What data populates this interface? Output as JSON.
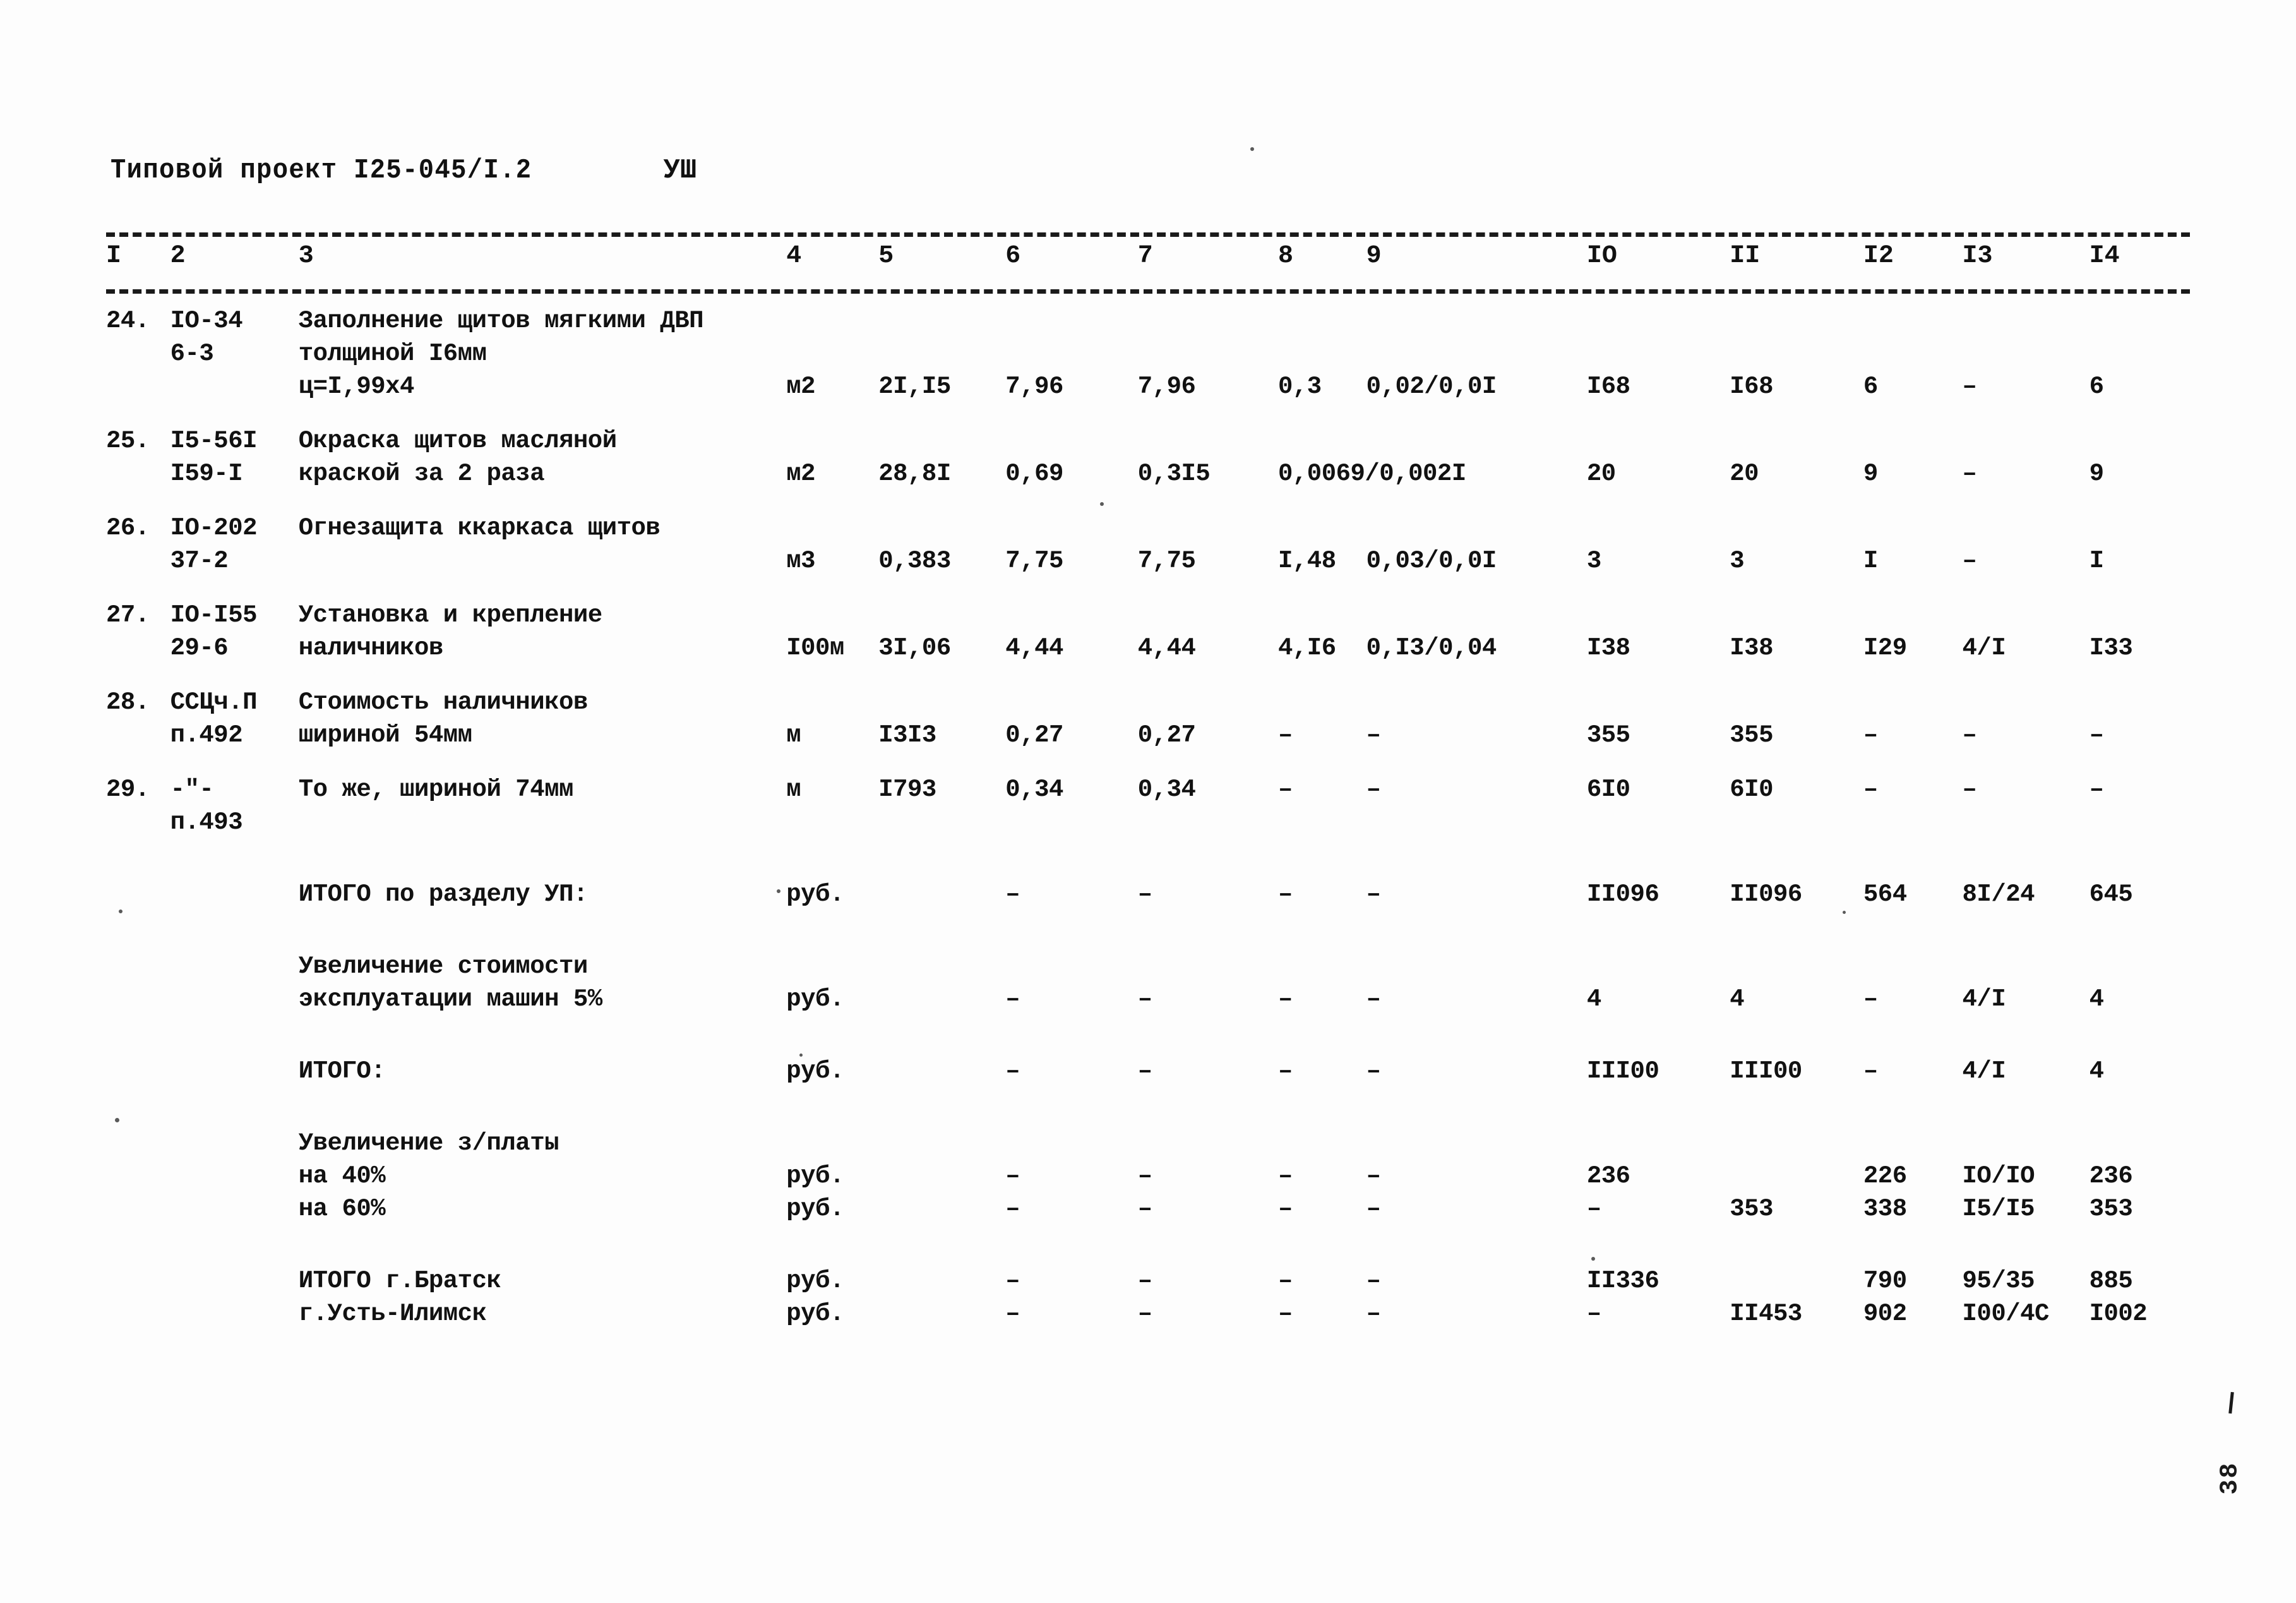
{
  "document": {
    "title": "Типовой проект I25-045/I.2",
    "section": "УШ",
    "page_number": "38"
  },
  "table": {
    "column_headers": [
      "I",
      "2",
      "3",
      "4",
      "5",
      "6",
      "7",
      "8",
      "9",
      "IO",
      "II",
      "I2",
      "I3",
      "I4"
    ],
    "rows": [
      {
        "num": "24.",
        "code_lines": [
          "IO-34",
          "6-3"
        ],
        "desc_lines": [
          "Заполнение щитов мягкими ДВП",
          "толщиной I6мм",
          "ц=I,99х4"
        ],
        "unit": "м2",
        "c5": "2I,I5",
        "c6": "7,96",
        "c7": "7,96",
        "c8": "0,3",
        "c9": "0,02/0,0I",
        "c10": "I68",
        "c11": "I68",
        "c12": "6",
        "c13": "–",
        "c14": "6"
      },
      {
        "num": "25.",
        "code_lines": [
          "I5-56I",
          "I59-I"
        ],
        "desc_lines": [
          "Окраска щитов масляной",
          "краской за 2 раза"
        ],
        "unit": "м2",
        "c5": "28,8I",
        "c6": "0,69",
        "c7": "0,3I5",
        "c8": "0,0069/0,002I",
        "c9": "",
        "c10": "20",
        "c11": "20",
        "c12": "9",
        "c13": "–",
        "c14": "9"
      },
      {
        "num": "26.",
        "code_lines": [
          "IO-202",
          "37-2"
        ],
        "desc_lines": [
          "Огнезащита ккаркаса щитов"
        ],
        "unit": "м3",
        "c5": "0,383",
        "c6": "7,75",
        "c7": "7,75",
        "c8": "I,48",
        "c9": "0,03/0,0I",
        "c10": "3",
        "c11": "3",
        "c12": "I",
        "c13": "–",
        "c14": "I"
      },
      {
        "num": "27.",
        "code_lines": [
          "IO-I55",
          "29-6"
        ],
        "desc_lines": [
          "Установка и крепление",
          "наличников"
        ],
        "unit": "I00м",
        "c5": "3I,06",
        "c6": "4,44",
        "c7": "4,44",
        "c8": "4,I6",
        "c9": "0,I3/0,04",
        "c10": "I38",
        "c11": "I38",
        "c12": "I29",
        "c13": "4/I",
        "c14": "I33"
      },
      {
        "num": "28.",
        "code_lines": [
          "ССЦч.П",
          "п.492"
        ],
        "desc_lines": [
          "Стоимость наличников",
          "шириной 54мм"
        ],
        "unit": "м",
        "c5": "I3I3",
        "c6": "0,27",
        "c7": "0,27",
        "c8": "–",
        "c9": "–",
        "c10": "355",
        "c11": "355",
        "c12": "–",
        "c13": "–",
        "c14": "–"
      },
      {
        "num": "29.",
        "code_lines": [
          "-\"-",
          "п.493"
        ],
        "desc_lines": [
          "То же, шириной 74мм"
        ],
        "unit": "м",
        "c5": "I793",
        "c6": "0,34",
        "c7": "0,34",
        "c8": "–",
        "c9": "–",
        "c10": "6I0",
        "c11": "6I0",
        "c12": "–",
        "c13": "–",
        "c14": "–"
      }
    ],
    "summary_rows": [
      {
        "desc_lines": [
          "ИТОГО по разделу УП:"
        ],
        "unit": "руб.",
        "c5": "",
        "c6": "–",
        "c7": "–",
        "c8": "–",
        "c9": "–",
        "c10": "II096",
        "c11": "II096",
        "c12": "564",
        "c13": "8I/24",
        "c14": "645"
      },
      {
        "desc_lines": [
          "Увеличение стоимости",
          "эксплуатации машин 5%"
        ],
        "unit": "руб.",
        "c5": "",
        "c6": "–",
        "c7": "–",
        "c8": "–",
        "c9": "–",
        "c10": "4",
        "c11": "4",
        "c12": "–",
        "c13": "4/I",
        "c14": "4"
      },
      {
        "desc_lines": [
          "ИТОГО:"
        ],
        "unit": "руб.",
        "c5": "",
        "c6": "–",
        "c7": "–",
        "c8": "–",
        "c9": "–",
        "c10": "III00",
        "c11": "III00",
        "c12": "–",
        "c13": "4/I",
        "c14": "4"
      }
    ],
    "salary_block": {
      "heading": "Увеличение з/платы",
      "lines": [
        {
          "desc": "на 40%",
          "unit": "руб.",
          "c6": "–",
          "c7": "–",
          "c8": "–",
          "c9": "–",
          "c10": "236",
          "c11": "",
          "c12": "226",
          "c13": "IO/IO",
          "c14": "236"
        },
        {
          "desc": "на 60%",
          "unit": "руб.",
          "c6": "–",
          "c7": "–",
          "c8": "–",
          "c9": "–",
          "c10": "–",
          "c11": "353",
          "c12": "338",
          "c13": "I5/I5",
          "c14": "353"
        }
      ]
    },
    "final_rows": [
      {
        "desc": "ИТОГО г.Братск",
        "unit": "руб.",
        "c6": "–",
        "c7": "–",
        "c8": "–",
        "c9": "–",
        "c10": "II336",
        "c11": "",
        "c12": "790",
        "c13": "95/35",
        "c14": "885"
      },
      {
        "desc": "г.Усть-Илимск",
        "unit": "руб.",
        "c6": "–",
        "c7": "–",
        "c8": "–",
        "c9": "–",
        "c10": "–",
        "c11": "II453",
        "c12": "902",
        "c13": "I00/4С",
        "c14": "I002"
      }
    ]
  }
}
